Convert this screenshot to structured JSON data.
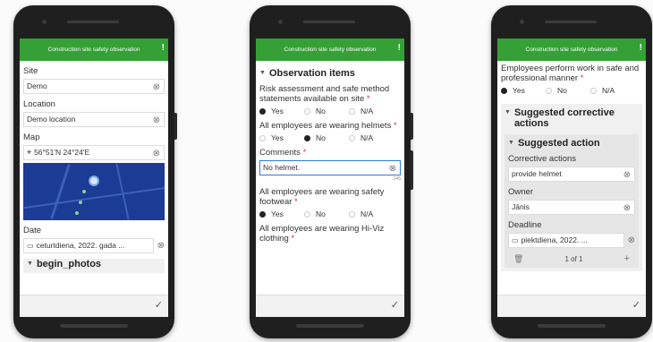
{
  "header_title": "Construction site safety observation",
  "phone1": {
    "site_label": "Site",
    "site_value": "Demo",
    "location_label": "Location",
    "location_value": "Demo location",
    "map_label": "Map",
    "map_coords": "56°51'N 24°24'E",
    "date_label": "Date",
    "date_value": "ceturtdiena, 2022. gada ...",
    "photos_group": "begin_photos"
  },
  "phone2": {
    "group_title": "Observation items",
    "q1": "Risk assessment and safe method statements available on site",
    "q1_selected": "Yes",
    "q2": "All employees are wearing helmets",
    "q2_selected": "No",
    "comments_label": "Comments",
    "comments_value": "No helmet.",
    "comments_counter": "245",
    "q3": "All employees are wearing safety footwear",
    "q3_selected": "Yes",
    "q4": "All employees are wearing Hi-Viz clothing"
  },
  "phone3": {
    "q5": "Employees perform work in safe and professional manner",
    "q5_selected": "Yes",
    "group_title": "Suggested corrective actions",
    "subgroup_title": "Suggested action",
    "corrective_label": "Corrective actions",
    "corrective_value": "provide helmet",
    "owner_label": "Owner",
    "owner_value": "Jānis",
    "deadline_label": "Deadline",
    "deadline_value": "piektdiena, 2022. ...",
    "pager": "1 of 1"
  },
  "options": {
    "yes": "Yes",
    "no": "No",
    "na": "N/A"
  },
  "required_marker": "*",
  "icons": {
    "clear": "clear-icon",
    "alert": "alert-icon",
    "check": "check-icon",
    "crosshair": "crosshair-icon",
    "calendar": "calendar-icon",
    "trash": "trash-icon",
    "plus": "plus-icon",
    "caret": "caret-down-icon"
  },
  "colors": {
    "header": "#35a035",
    "required": "#d43a3a",
    "focus": "#2f7bd6",
    "map": "#1b3b95"
  }
}
